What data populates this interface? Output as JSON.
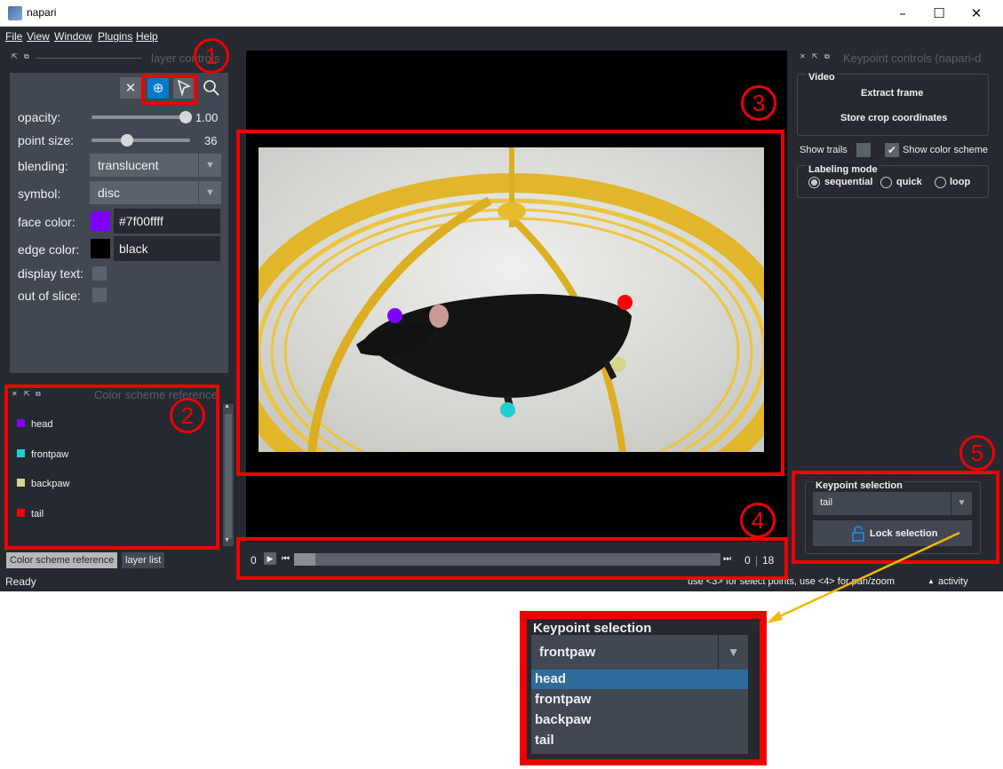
{
  "window": {
    "title": "napari",
    "minimize_glyph": "–",
    "maximize_glyph": "☐",
    "close_glyph": "✕"
  },
  "menu": [
    "File",
    "View",
    "Window",
    "Plugins",
    "Help"
  ],
  "layer_controls": {
    "title": "layer controls",
    "rows": {
      "opacity": {
        "label": "opacity:",
        "value": "1.00",
        "fraction": 1.0
      },
      "point_size": {
        "label": "point size:",
        "value": "36",
        "fraction": 0.36
      },
      "blending": {
        "label": "blending:",
        "value": "translucent"
      },
      "symbol": {
        "label": "symbol:",
        "value": "disc"
      },
      "face_color": {
        "label": "face color:",
        "value": "#7f00ffff",
        "swatch": "#7f00ff"
      },
      "edge_color": {
        "label": "edge color:",
        "value": "black",
        "swatch": "#000000"
      },
      "display_text": {
        "label": "display text:"
      },
      "out_of_slice": {
        "label": "out of slice:"
      }
    }
  },
  "color_scheme": {
    "title": "Color scheme reference",
    "items": [
      {
        "label": "head",
        "color": "#7f00ff"
      },
      {
        "label": "frontpaw",
        "color": "#1ecfd0"
      },
      {
        "label": "backpaw",
        "color": "#d6d48a"
      },
      {
        "label": "tail",
        "color": "#ff0000"
      }
    ]
  },
  "bottom_tabs": [
    "Color scheme reference",
    "layer list"
  ],
  "status": {
    "ready": "Ready",
    "help": "use <3> for select points, use <4> for pan/zoom",
    "activity": "activity"
  },
  "dims": {
    "start": "0",
    "current": "0",
    "max": "18"
  },
  "keypoint_controls": {
    "title": "Keypoint controls (napari-d",
    "video_group": "Video",
    "extract_frame": "Extract frame",
    "store_crop": "Store crop coordinates",
    "show_trails": "Show trails",
    "show_color_scheme": "Show color scheme",
    "labeling_mode": "Labeling mode",
    "modes": [
      "sequential",
      "quick",
      "loop"
    ],
    "selected_mode": "sequential",
    "keypoint_selection": "Keypoint selection",
    "selected_keypoint": "tail",
    "lock_selection": "Lock selection"
  },
  "inset": {
    "title": "Keypoint selection",
    "current": "frontpaw",
    "options": [
      "head",
      "frontpaw",
      "backpaw",
      "tail"
    ],
    "highlighted": "head"
  },
  "annotations": [
    "1",
    "2",
    "3",
    "4",
    "5"
  ],
  "colors": {
    "annotation_red": "#ee0000",
    "arrow_yellow": "#f5b800",
    "accent": "#007acc",
    "panel": "#414851",
    "background": "#262930"
  }
}
